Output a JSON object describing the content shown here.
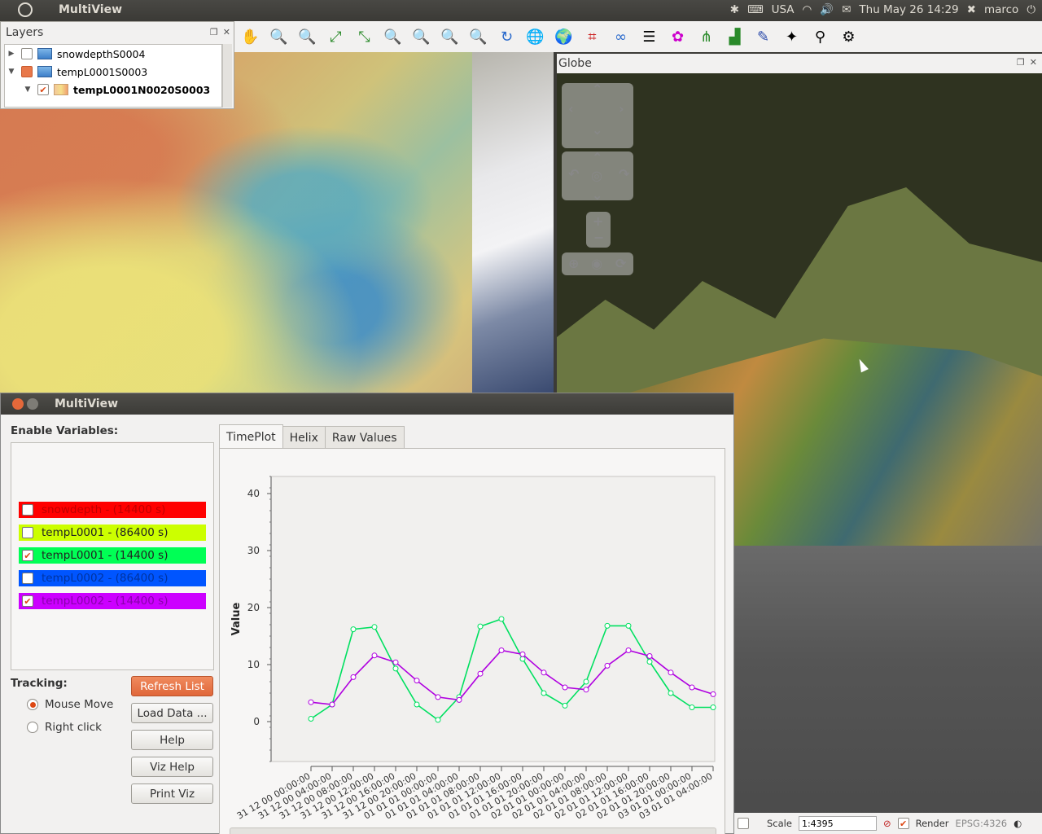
{
  "top_panel": {
    "app_title": "MultiView",
    "keyboard": "USA",
    "datetime": "Thu May 26 14:29",
    "user": "marco"
  },
  "layers": {
    "title": "Layers",
    "items": [
      {
        "label": "snowdepthS0004"
      },
      {
        "label": "tempL0001S0003"
      },
      {
        "label": "tempL0001N0020S0003"
      }
    ]
  },
  "globe": {
    "title": "Globe"
  },
  "status": {
    "scale_label": "Scale",
    "scale_value": "1:4395",
    "render_label": "Render",
    "crs": "EPSG:4326"
  },
  "multiview": {
    "title": "MultiView",
    "enable_label": "Enable Variables:",
    "variables": [
      {
        "label": "snowdepth - (14400 s)",
        "checked": false,
        "color": "#ff0000"
      },
      {
        "label": "tempL0001 - (86400 s)",
        "checked": false,
        "color": "#ccff00"
      },
      {
        "label": "tempL0001 - (14400 s)",
        "checked": true,
        "color": "#00ff55"
      },
      {
        "label": "tempL0002 - (86400 s)",
        "checked": false,
        "color": "#0055ff"
      },
      {
        "label": "tempL0002 - (14400 s)",
        "checked": true,
        "color": "#cc00ff"
      }
    ],
    "tracking_label": "Tracking:",
    "radio_mouse": "Mouse Move",
    "radio_right": "Right click",
    "buttons": {
      "refresh": "Refresh List",
      "load": "Load Data ...",
      "help": "Help",
      "viz_help": "Viz Help",
      "print_viz": "Print Viz"
    },
    "tabs": [
      "TimePlot",
      "Helix",
      "Raw Values"
    ]
  },
  "chart_data": {
    "type": "line",
    "ylabel": "Value",
    "ylim": [
      -7,
      43
    ],
    "yticks": [
      0,
      10,
      20,
      30,
      40
    ],
    "x": [
      "31 12 00 00:00:00",
      "31 12 00 04:00:00",
      "31 12 00 08:00:00",
      "31 12 00 12:00:00",
      "31 12 00 16:00:00",
      "31 12 00 20:00:00",
      "01 01 01 00:00:00",
      "01 01 01 04:00:00",
      "01 01 01 08:00:00",
      "01 01 01 12:00:00",
      "01 01 01 16:00:00",
      "01 01 01 20:00:00",
      "02 01 01 00:00:00",
      "02 01 01 04:00:00",
      "02 01 01 08:00:00",
      "02 01 01 12:00:00",
      "02 01 01 16:00:00",
      "02 01 01 20:00:00",
      "03 01 01 00:00:00",
      "03 01 01 04:00:00"
    ],
    "series": [
      {
        "color": "#00e060",
        "values": [
          0.5,
          3.0,
          16.2,
          16.6,
          9.3,
          3.0,
          0.3,
          4.3,
          16.7,
          18.0,
          11.0,
          5.0,
          2.8,
          7.0,
          16.8,
          16.8,
          10.5,
          5.0,
          2.5,
          2.5
        ]
      },
      {
        "color": "#b000e0",
        "values": [
          3.4,
          3.0,
          7.8,
          11.6,
          10.4,
          7.2,
          4.3,
          3.8,
          8.4,
          12.5,
          11.8,
          8.6,
          6.0,
          5.6,
          9.8,
          12.5,
          11.5,
          8.6,
          6.0,
          4.8
        ]
      }
    ]
  }
}
